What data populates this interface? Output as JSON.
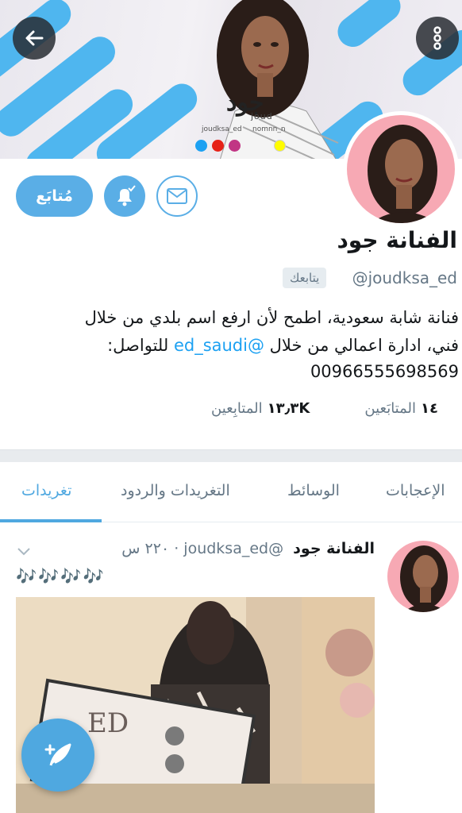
{
  "banner": {
    "title": "جود",
    "subtitle": "joud",
    "handle_left": "joudksa_ed",
    "handle_right": "nomnn_n"
  },
  "profile": {
    "follow_label": "مُتابَع",
    "name": "الفنانة جود",
    "handle": "@joudksa_ed",
    "follows_you": "يتابعك",
    "bio_line1": "فنانة شابة سعودية، اطمح لأن ارفع اسم بلدي من خلال",
    "bio_line2_pre": "فني، ادارة اعمالي من خلال ",
    "bio_mention": "@ed_saudi",
    "bio_line2_post": " للتواصل:",
    "bio_phone": "00966555698569",
    "following_count": "١٤",
    "following_label": "المتابَعين",
    "followers_count": "١٣٫٣K",
    "followers_label": "المتابِعين"
  },
  "tabs": [
    {
      "label": "الإعجابات"
    },
    {
      "label": "الوسائط"
    },
    {
      "label": "التغريدات والردود"
    },
    {
      "label": "تغريدات",
      "active": true
    }
  ],
  "tweet": {
    "author": "الفنانة جود",
    "handle": "@joudksa_ed",
    "time": "· ٢٢٠ س",
    "text": "🎶🎶🎶🎶"
  },
  "colors": {
    "accent": "#4fa8e0",
    "banner_stripe": "#4fb6ef",
    "avatar_bg": "#f7a9b4",
    "emoji": "#a04bd6"
  }
}
